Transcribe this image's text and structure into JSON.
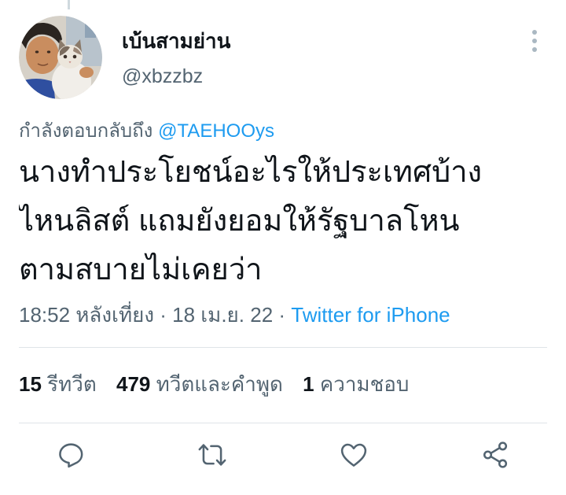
{
  "tweet": {
    "author": {
      "display_name": "เบ้นสามย่าน",
      "handle": "@xbzzbz"
    },
    "more_icon": "more-vertical-icon",
    "reply_to": {
      "prefix": "กำลังตอบกลับถึง",
      "mention": "@TAEHOOys"
    },
    "text_lines": [
      "นางทำประโยชน์อะไรให้ประเทศบ้าง",
      "ไหนลิสต์ แถมยังยอมให้รัฐบาลโหน",
      "ตามสบายไม่เคยว่า"
    ],
    "meta": {
      "time": "18:52 หลังเที่ยง",
      "separator": "·",
      "date": "18 เม.ย. 22",
      "source": "Twitter for iPhone"
    },
    "stats": [
      {
        "count": "15",
        "label": "รีทวีต"
      },
      {
        "count": "479",
        "label": "ทวีตและคำพูด"
      },
      {
        "count": "1",
        "label": "ความชอบ"
      }
    ],
    "actions": [
      {
        "icon": "reply-icon"
      },
      {
        "icon": "retweet-icon"
      },
      {
        "icon": "like-icon"
      },
      {
        "icon": "share-icon"
      }
    ]
  },
  "colors": {
    "text": "#0f1419",
    "muted": "#536471",
    "accent": "#1d9bf0",
    "divider": "#dfe4e8",
    "icon": "#536471",
    "dots": "#aab8c2"
  }
}
